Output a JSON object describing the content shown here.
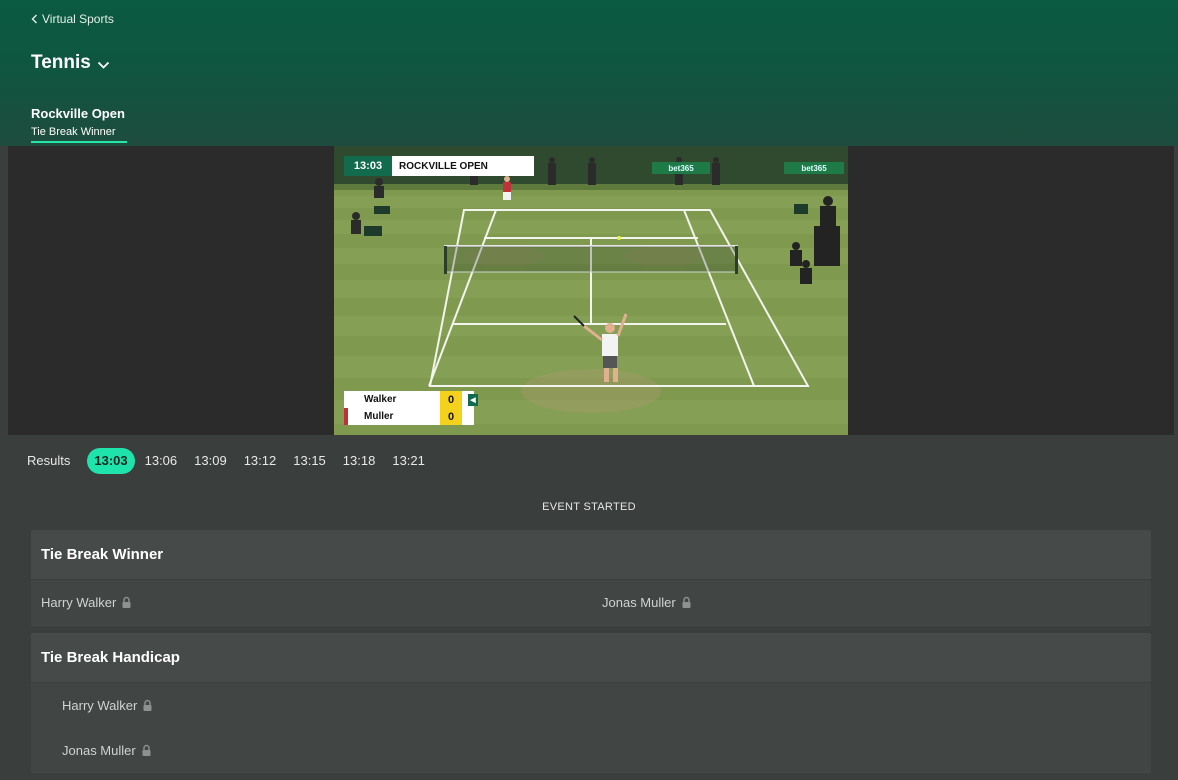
{
  "header": {
    "back_label": "Virtual Sports",
    "sport": "Tennis",
    "event_name": "Rockville Open",
    "active_tab": "Tie Break Winner"
  },
  "video": {
    "clock": "13:03",
    "tournament": "ROCKVILLE OPEN",
    "sponsor": "bet365",
    "scoreboard": [
      {
        "name": "Walker",
        "score": "0",
        "serving": true
      },
      {
        "name": "Muller",
        "score": "0",
        "serving": false
      }
    ]
  },
  "times": {
    "results_label": "Results",
    "slots": [
      "13:03",
      "13:06",
      "13:09",
      "13:12",
      "13:15",
      "13:18",
      "13:21"
    ],
    "active": "13:03"
  },
  "status": "EVENT STARTED",
  "markets": [
    {
      "title": "Tie Break Winner",
      "selections": [
        "Harry Walker",
        "Jonas Muller"
      ],
      "locked": true
    },
    {
      "title": "Tie Break Handicap",
      "selections": [
        "Harry Walker",
        "Jonas Muller"
      ],
      "locked": true
    }
  ],
  "colors": {
    "accent": "#1ee3aa",
    "header_green": "#0b5a42",
    "background": "#3a3e3c"
  },
  "icons": {
    "back": "chevron-left-icon",
    "dropdown": "chevron-down-icon",
    "lock": "lock-icon"
  }
}
